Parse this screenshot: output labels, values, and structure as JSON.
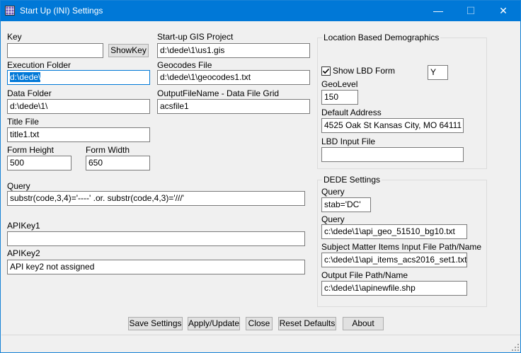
{
  "window": {
    "title": "Start Up (INI) Settings",
    "minimize": "—",
    "maximize": "☐",
    "close": "✕"
  },
  "left": {
    "key_label": "Key",
    "key_value": "",
    "showkey_label": "ShowKey",
    "exec_label": "Execution Folder",
    "exec_value": "d:\\dede\\",
    "data_label": "Data Folder",
    "data_value": "d:\\dede\\1\\",
    "title_label": "Title File",
    "title_value": "title1.txt",
    "height_label": "Form Height",
    "height_value": "500",
    "width_label": "Form Width",
    "width_value": "650",
    "query_label": "Query",
    "query_value": "substr(code,3,4)='----' .or. substr(code,4,3)='///'",
    "api1_label": "APIKey1",
    "api1_value": "",
    "api2_label": "APIKey2",
    "api2_value": "API key2 not assigned"
  },
  "middle": {
    "gis_label": "Start-up GIS Project",
    "gis_value": "d:\\dede\\1\\us1.gis",
    "geocodes_label": "Geocodes File",
    "geocodes_value": "d:\\dede\\1\\geocodes1.txt",
    "output_label": "OutputFileName - Data File Grid",
    "output_value": "acsfile1"
  },
  "lbd": {
    "group_title": "Location Based Demographics",
    "show_lbd_label": "Show LBD Form",
    "show_lbd_checked": true,
    "y_value": "Y",
    "geolevel_label": "GeoLevel",
    "geolevel_value": "150",
    "address_label": "Default Address",
    "address_value": "4525 Oak St  Kansas City, MO 64111",
    "input_label": "LBD Input File",
    "input_value": ""
  },
  "dede": {
    "group_title": "DEDE Settings",
    "query1_label": "Query",
    "query1_value": "stab='DC'",
    "query2_label": "Query",
    "query2_value": "c:\\dede\\1\\api_geo_51510_bg10.txt",
    "subject_label": "Subject Matter Items Input File Path/Name",
    "subject_value": "c:\\dede\\1\\api_items_acs2016_set1.txt",
    "outfile_label": "Output File Path/Name",
    "outfile_value": "c:\\dede\\1\\apinewfile.shp"
  },
  "buttons": {
    "save": "Save Settings",
    "apply": "Apply/Update",
    "close": "Close",
    "reset": "Reset Defaults",
    "about": "About"
  },
  "colors": {
    "titlebar": "#0078d7",
    "selection": "#0078d7",
    "background": "#f0f0f0"
  }
}
